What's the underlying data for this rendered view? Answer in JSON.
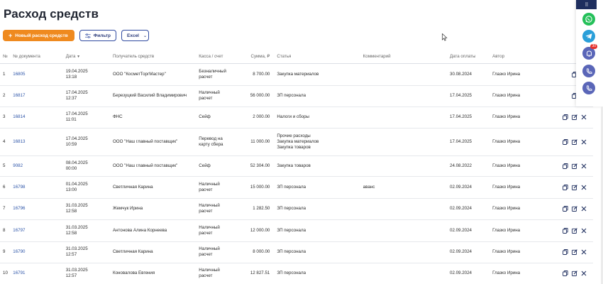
{
  "page": {
    "title": "Расход средств"
  },
  "toolbar": {
    "new_label": "Новый расход средств",
    "filter_label": "Фильтр",
    "excel_label": "Excel"
  },
  "table": {
    "headers": {
      "num": "№",
      "doc": "№ документа",
      "date": "Дата",
      "recipient": "Получатель средств",
      "cash": "Касса / счет",
      "sum": "Сумма, ₽",
      "article": "Статья",
      "comment": "Комментарий",
      "pay_date": "Дата оплаты",
      "author": "Автор"
    },
    "rows": [
      {
        "num": "1",
        "doc": "16805",
        "date": "19.04.2025",
        "time": "13:18",
        "recipient": "ООО \"КосметТоргМастер\"",
        "cash": [
          "Безналичный",
          "расчет"
        ],
        "sum": "8 700.00",
        "article": [
          "Закупка материалов"
        ],
        "comment": "",
        "pay_date": "30.08.2024",
        "author": "Глазко Ирина"
      },
      {
        "num": "2",
        "doc": "16817",
        "date": "17.04.2025",
        "time": "12:37",
        "recipient": "Березуцкий Василий Владимирович",
        "cash": [
          "Наличный",
          "расчет"
        ],
        "sum": "56 000.00",
        "article": [
          "ЗП персонала"
        ],
        "comment": "",
        "pay_date": "17.04.2025",
        "author": "Глазко Ирина"
      },
      {
        "num": "3",
        "doc": "16814",
        "date": "17.04.2025",
        "time": "11:01",
        "recipient": "ФНС",
        "cash": [
          "Сейф"
        ],
        "sum": "2 000.00",
        "article": [
          "Налоги и сборы"
        ],
        "comment": "",
        "pay_date": "17.04.2025",
        "author": "Глазко Ирина"
      },
      {
        "num": "4",
        "doc": "16813",
        "date": "17.04.2025",
        "time": "10:59",
        "recipient": "ООО \"Наш главный поставщик\"",
        "cash": [
          "Перевод на",
          "карту сбера"
        ],
        "sum": "11 000.00",
        "article": [
          "Прочие расходы",
          "Закупка материалов",
          "Закупка товаров"
        ],
        "comment": "",
        "pay_date": "17.04.2025",
        "author": "Глазко Ирина"
      },
      {
        "num": "5",
        "doc": "9082",
        "date": "08.04.2025",
        "time": "00:00",
        "recipient": "ООО \"Наш главный поставщик\"",
        "cash": [
          "Сейф"
        ],
        "sum": "52 304.00",
        "article": [
          "Закупка товаров"
        ],
        "comment": "",
        "pay_date": "24.08.2022",
        "author": "Глазко Ирина"
      },
      {
        "num": "6",
        "doc": "16798",
        "date": "01.04.2025",
        "time": "13:00",
        "recipient": "Светличная Карина",
        "cash": [
          "Наличный",
          "расчет"
        ],
        "sum": "15 000.00",
        "article": [
          "ЗП персонала"
        ],
        "comment": "аванс",
        "pay_date": "02.09.2024",
        "author": "Глазко Ирина"
      },
      {
        "num": "7",
        "doc": "16796",
        "date": "31.03.2025",
        "time": "12:58",
        "recipient": "Жемчук Ирина",
        "cash": [
          "Наличный",
          "расчет"
        ],
        "sum": "1 282.50",
        "article": [
          "ЗП персонала"
        ],
        "comment": "",
        "pay_date": "02.09.2024",
        "author": "Глазко Ирина"
      },
      {
        "num": "8",
        "doc": "16797",
        "date": "31.03.2025",
        "time": "12:58",
        "recipient": "Антонова Алина Корнеева",
        "cash": [
          "Наличный",
          "расчет"
        ],
        "sum": "12 000.00",
        "article": [
          "ЗП персонала"
        ],
        "comment": "",
        "pay_date": "02.09.2024",
        "author": "Глазко Ирина"
      },
      {
        "num": "9",
        "doc": "16790",
        "date": "31.03.2025",
        "time": "12:57",
        "recipient": "Светличная Карина",
        "cash": [
          "Наличный",
          "расчет"
        ],
        "sum": "8 000.00",
        "article": [
          "ЗП персонала"
        ],
        "comment": "",
        "pay_date": "02.09.2024",
        "author": "Глазко Ирина"
      },
      {
        "num": "10",
        "doc": "16791",
        "date": "31.03.2025",
        "time": "12:57",
        "recipient": "Коновалова Евгения",
        "cash": [
          "Наличный",
          "расчет"
        ],
        "sum": "12 827.51",
        "article": [
          "ЗП персонала"
        ],
        "comment": "",
        "pay_date": "02.09.2024",
        "author": "Глазко Ирина"
      }
    ]
  },
  "sidebar": {
    "notification_count": "30",
    "icons": [
      "menu-dots-icon",
      "whatsapp-icon",
      "telegram-icon",
      "bell-icon",
      "phone-call-icon",
      "phone-call-icon"
    ]
  },
  "colors": {
    "primary_orange": "#ef8a1f",
    "outline_blue": "#2f4aa0",
    "link_blue": "#2c54a8",
    "sidebar_navy": "#1e2e5e",
    "whatsapp_green": "#25c05a",
    "telegram_blue": "#2a9fd9",
    "badge_red": "#e5322d",
    "icon_indigo": "#5a66b8"
  }
}
